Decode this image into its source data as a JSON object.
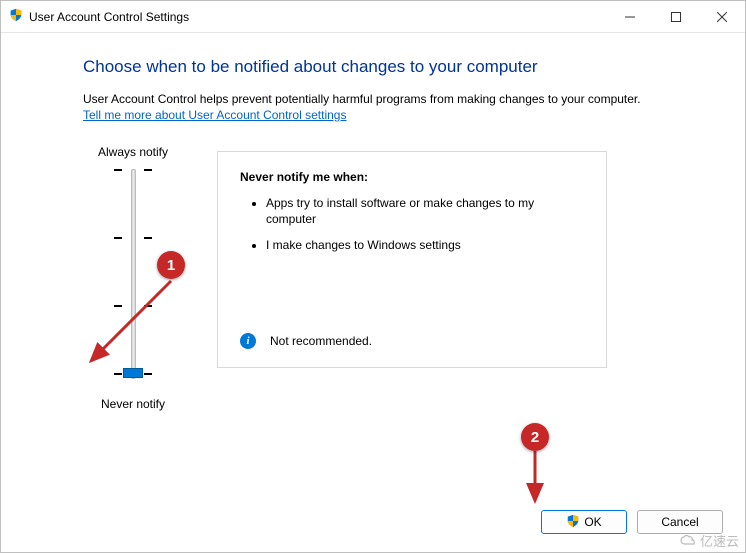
{
  "window": {
    "title": "User Account Control Settings"
  },
  "heading": "Choose when to be notified about changes to your computer",
  "description": "User Account Control helps prevent potentially harmful programs from making changes to your computer.",
  "link_text": "Tell me more about User Account Control settings",
  "slider": {
    "top_label": "Always notify",
    "bottom_label": "Never notify",
    "level_count": 4,
    "current_level": 0
  },
  "notify_box": {
    "title": "Never notify me when:",
    "bullets": [
      "Apps try to install software or make changes to my computer",
      "I make changes to Windows settings"
    ],
    "recommendation": "Not recommended."
  },
  "buttons": {
    "ok": "OK",
    "cancel": "Cancel"
  },
  "annotations": {
    "badge1": "1",
    "badge2": "2"
  },
  "watermark": "亿速云"
}
